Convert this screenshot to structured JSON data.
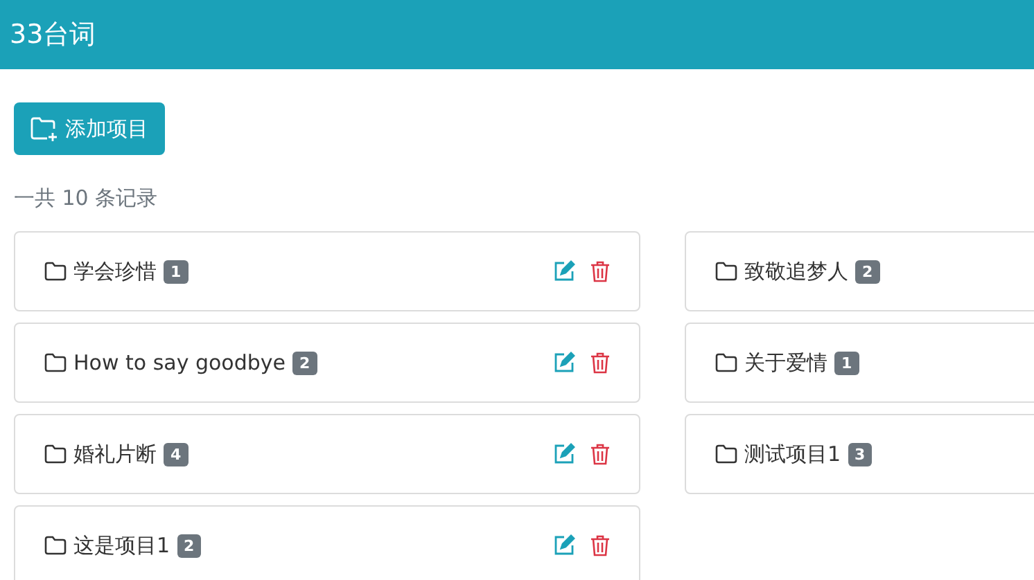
{
  "header": {
    "title": "33台词"
  },
  "add_button": {
    "label": "添加项目"
  },
  "record_count": "一共 10 条记录",
  "columns": [
    [
      {
        "title": "学会珍惜",
        "count": "1"
      },
      {
        "title": "How to say goodbye",
        "count": "2"
      },
      {
        "title": "婚礼片断",
        "count": "4"
      },
      {
        "title": "这是项目1",
        "count": "2"
      }
    ],
    [
      {
        "title": "致敬追梦人",
        "count": "2"
      },
      {
        "title": "关于爱情",
        "count": "1"
      },
      {
        "title": "测试项目1",
        "count": "3"
      }
    ]
  ]
}
